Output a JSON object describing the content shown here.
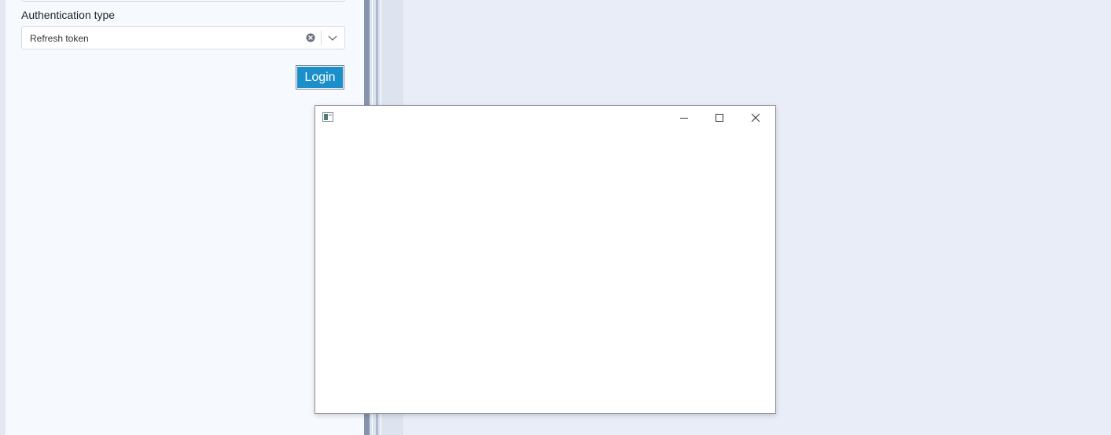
{
  "login_form": {
    "auth_type_label": "Authentication type",
    "auth_type_value": "Refresh token",
    "login_button_label": "Login"
  },
  "popup": {
    "title": "",
    "controls": {
      "minimize_icon": "minimize-icon",
      "maximize_icon": "maximize-icon",
      "close_icon": "close-icon"
    }
  },
  "colors": {
    "accent": "#1a8fc9",
    "panel_background": "#f6f9fe",
    "window_background": "#e9edf7",
    "splitter": "#8593ad"
  }
}
